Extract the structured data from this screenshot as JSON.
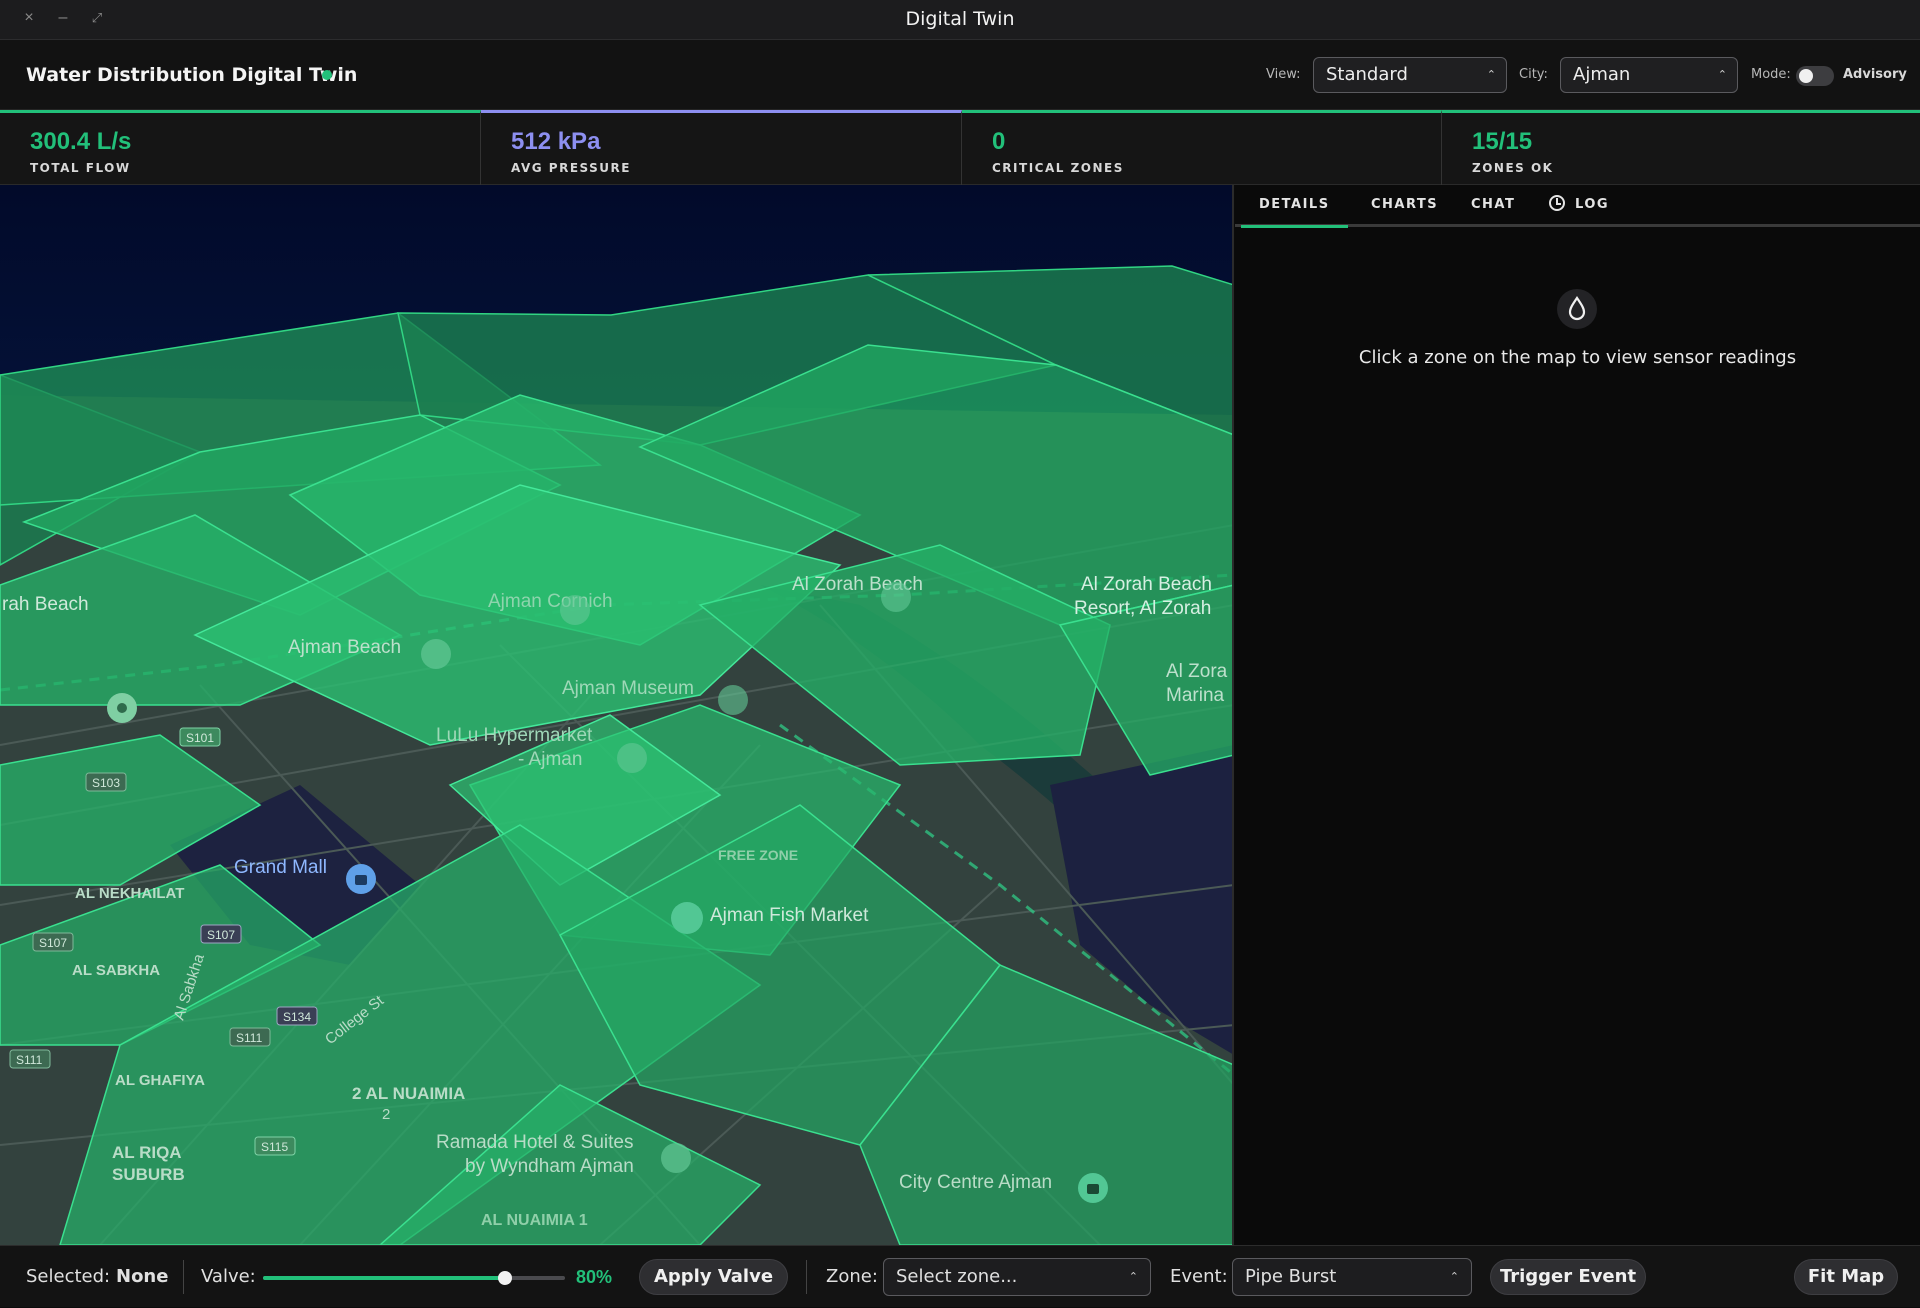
{
  "window": {
    "title": "Digital Twin"
  },
  "header": {
    "app_title": "Water Distribution Digital Twin",
    "view_label": "View:",
    "view_value": "Standard",
    "city_label": "City:",
    "city_value": "Ajman",
    "mode_label": "Mode:",
    "mode_value": "Advisory",
    "mode_toggle_on": false
  },
  "stats": [
    {
      "value": "300.4 L/s",
      "label": "TOTAL FLOW",
      "color": "#22c07a"
    },
    {
      "value": "512 kPa",
      "label": "AVG PRESSURE",
      "color": "#8d8ff0"
    },
    {
      "value": "0",
      "label": "CRITICAL ZONES",
      "color": "#22c07a"
    },
    {
      "value": "15/15",
      "label": "ZONES OK",
      "color": "#22c07a"
    }
  ],
  "side_panel": {
    "tabs": [
      "DETAILS",
      "CHARTS",
      "CHAT",
      "LOG"
    ],
    "active_tab": "DETAILS",
    "empty_message": "Click a zone on the map to view sensor readings"
  },
  "map": {
    "labels": {
      "beach_left": "rah Beach",
      "ajman_beach": "Ajman Beach",
      "ajman_corniche": "Ajman Cornich",
      "al_zorah_beach": "Al Zorah Beach",
      "al_zorah_resort_1": "Al Zorah Beach",
      "al_zorah_resort_2": "Resort, Al Zorah",
      "al_zorah_marina_1": "Al Zora",
      "al_zorah_marina_2": "Marina",
      "ajman_museum": "Ajman Museum",
      "lulu_1": "LuLu Hypermarket",
      "lulu_2": "- Ajman",
      "free_zone": "FREE ZONE",
      "grand_mall": "Grand Mall",
      "fish_market": "Ajman Fish Market",
      "al_nekhailat": "AL NEKHAILAT",
      "al_sabkha": "AL SABKHA",
      "al_ghafiya": "AL GHAFIYA",
      "al_riqa_1": "AL RIQA",
      "al_riqa_2": "SUBURB",
      "al_nuaimia_2": "2 AL NUAIMIA",
      "al_nuaimia_2b": "2",
      "ramada_1": "Ramada Hotel & Suites",
      "ramada_2": "by Wyndham Ajman",
      "al_nuaimia_1": "AL NUAIMIA 1",
      "city_centre": "City Centre Ajman",
      "college_st": "College St",
      "al_sabkha_rd": "Al Sabkha",
      "s103": "S103",
      "s107a": "S107",
      "s107b": "S107",
      "s134": "S134",
      "s111a": "S111",
      "s111b": "S111",
      "s101": "S101",
      "s115": "S115"
    }
  },
  "footer": {
    "selected_label": "Selected:",
    "selected_value": "None",
    "valve_label": "Valve:",
    "valve_percent": 80,
    "valve_text": "80%",
    "apply_valve": "Apply Valve",
    "zone_label": "Zone:",
    "zone_placeholder": "Select zone...",
    "event_label": "Event:",
    "event_value": "Pipe Burst",
    "trigger_event": "Trigger Event",
    "fit_map": "Fit Map"
  }
}
